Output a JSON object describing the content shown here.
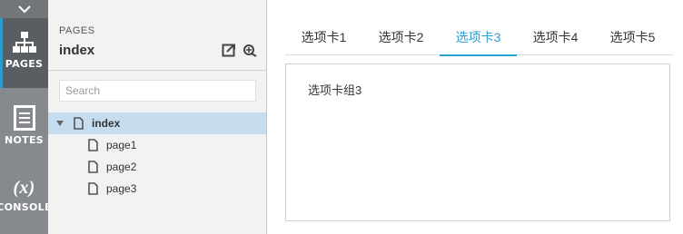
{
  "rail": {
    "collapse_icon": "chevron-down-icon",
    "items": [
      {
        "label": "PAGES",
        "icon": "sitemap-icon",
        "active": true
      },
      {
        "label": "NOTES",
        "icon": "notes-icon",
        "active": false
      },
      {
        "label": "CONSOLE",
        "icon": "fx-icon",
        "glyph": "(x)",
        "active": false
      }
    ]
  },
  "panel": {
    "caption": "PAGES",
    "title": "index",
    "actions": [
      "export-icon",
      "add-page-icon"
    ],
    "search_placeholder": "Search",
    "tree": [
      {
        "label": "index",
        "level": 0,
        "expanded": true,
        "selected": true
      },
      {
        "label": "page1",
        "level": 1
      },
      {
        "label": "page2",
        "level": 1
      },
      {
        "label": "page3",
        "level": 1
      }
    ]
  },
  "tabs": {
    "items": [
      "选项卡1",
      "选项卡2",
      "选项卡3",
      "选项卡4",
      "选项卡5"
    ],
    "active_index": 2,
    "content": "选项卡组3"
  },
  "colors": {
    "accent": "#2b9ed2",
    "rail": "#868a8e",
    "rail_active": "#5a5e62",
    "tree_selected": "#c6ddef"
  }
}
